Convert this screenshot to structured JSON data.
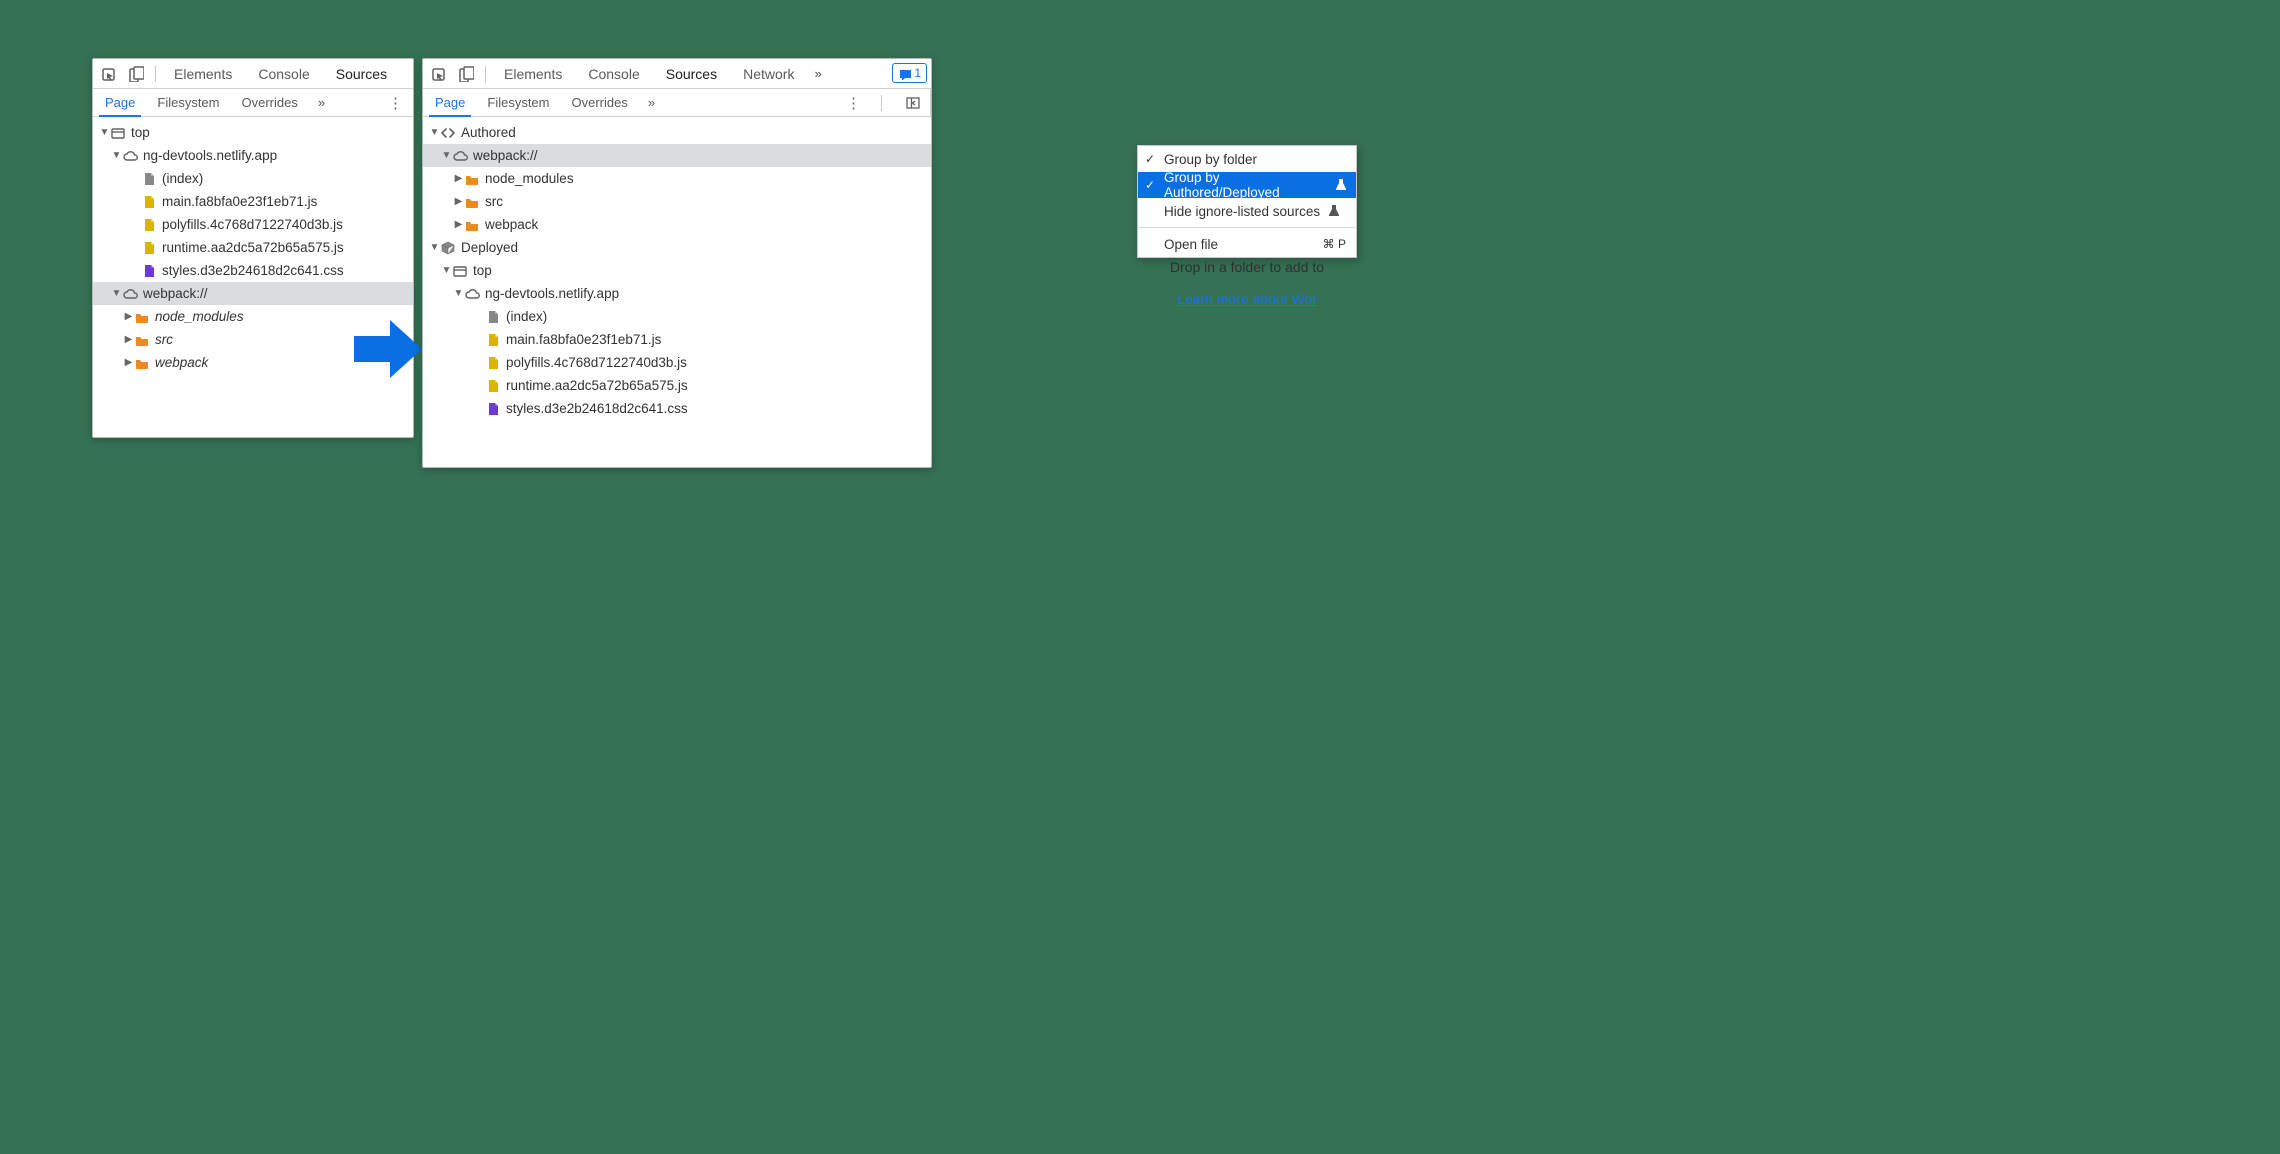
{
  "tabs": {
    "elements": "Elements",
    "console": "Console",
    "sources": "Sources",
    "network": "Network"
  },
  "subtabs": {
    "page": "Page",
    "filesystem": "Filesystem",
    "overrides": "Overrides"
  },
  "feedback_count": "1",
  "left_tree": {
    "top": "top",
    "domain": "ng-devtools.netlify.app",
    "index": "(index)",
    "files": [
      "main.fa8bfa0e23f1eb71.js",
      "polyfills.4c768d7122740d3b.js",
      "runtime.aa2dc5a72b65a575.js",
      "styles.d3e2b24618d2c641.css"
    ],
    "webpack": "webpack://",
    "folders": [
      "node_modules",
      "src",
      "webpack"
    ]
  },
  "right_tree": {
    "authored": "Authored",
    "webpack": "webpack://",
    "folders": [
      "node_modules",
      "src",
      "webpack"
    ],
    "deployed": "Deployed",
    "top": "top",
    "domain": "ng-devtools.netlify.app",
    "index": "(index)",
    "files": [
      "main.fa8bfa0e23f1eb71.js",
      "polyfills.4c768d7122740d3b.js",
      "runtime.aa2dc5a72b65a575.js",
      "styles.d3e2b24618d2c641.css"
    ]
  },
  "ctx": {
    "group_by_folder": "Group by folder",
    "group_by_authored": "Group by Authored/Deployed",
    "hide_ignored": "Hide ignore-listed sources",
    "open_file": "Open file",
    "open_file_shortcut": "⌘ P"
  },
  "drop": {
    "line": "Drop in a folder to add to",
    "link": "Learn more about Wor"
  }
}
